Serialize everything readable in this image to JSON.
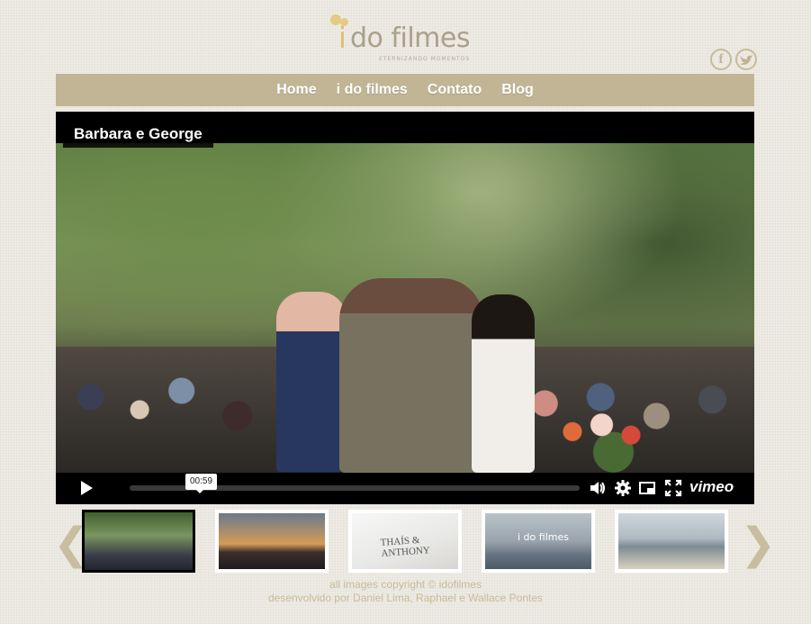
{
  "brand": {
    "logo_i": "i",
    "logo_rest": "do filmes",
    "tagline": "ETERNIZANDO MOMENTOS",
    "accent_color": "#c1b596",
    "gold_color": "#e3be6f"
  },
  "social": {
    "facebook_label": "f",
    "twitter_label": "t"
  },
  "nav": {
    "items": [
      {
        "label": "Home"
      },
      {
        "label": "i do filmes"
      },
      {
        "label": "Contato"
      },
      {
        "label": "Blog"
      }
    ]
  },
  "player": {
    "title": "Barbara e George",
    "hover_time": "00:59",
    "progress_fraction": 0.0,
    "brand": "vimeo"
  },
  "carousel": {
    "prev_label": "❮",
    "next_label": "❯",
    "thumbs": [
      {
        "caption": ""
      },
      {
        "caption": ""
      },
      {
        "caption": "THAÍS & ANTHONY"
      },
      {
        "caption": "i do filmes"
      },
      {
        "caption": ""
      }
    ],
    "active_index": 0
  },
  "footer": {
    "line1": "all images copyright © idofilmes",
    "line2": "desenvolvido por Daniel Lima, Raphael e Wallace Pontes"
  }
}
